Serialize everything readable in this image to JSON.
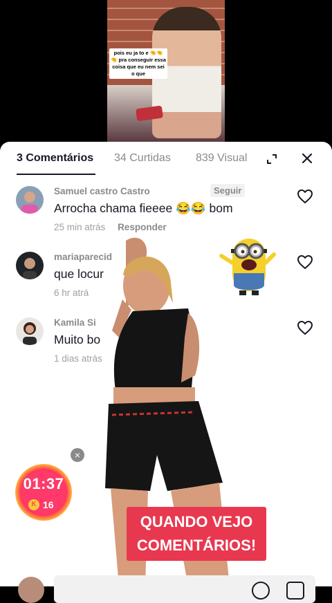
{
  "video": {
    "caption": "pois eu ja to e 🤏🤏🤏 pra conseguir essa coisa que eu nem sei o que"
  },
  "tabs": [
    {
      "label": "3 Comentários",
      "active": true
    },
    {
      "label": "34 Curtidas",
      "active": false
    },
    {
      "label": "839 Visual",
      "active": false
    }
  ],
  "comments": [
    {
      "user": "Samuel castro Castro",
      "follow": "Seguir",
      "text": "Arrocha chama fieeee 😂😂 bom",
      "time": "25 min atrás",
      "reply": "Responder"
    },
    {
      "user": "mariaparecid",
      "text": "que locur",
      "time": "6 hr atrá"
    },
    {
      "user": "Kamila Si",
      "text": "Muito bo",
      "time": "1 dias atrás"
    }
  ],
  "overlay": {
    "banner_line1": "QUANDO VEJO",
    "banner_line2": "COMENTÁRIOS!"
  },
  "timer": {
    "time": "01:37",
    "coin_letter": "K",
    "coins": "16"
  },
  "colors": {
    "accent": "#e8384f",
    "text_primary": "#161823",
    "text_secondary": "#8a8a8a"
  }
}
